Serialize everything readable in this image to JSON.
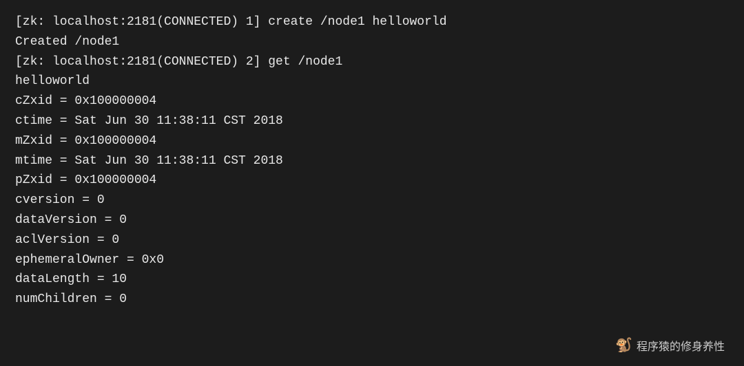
{
  "terminal": {
    "background": "#1c1c1c",
    "lines": [
      {
        "id": "line1",
        "text": "[zk: localhost:2181(CONNECTED) 1] create /node1 helloworld"
      },
      {
        "id": "line2",
        "text": "Created /node1"
      },
      {
        "id": "line3",
        "text": "[zk: localhost:2181(CONNECTED) 2] get /node1"
      },
      {
        "id": "line4",
        "text": "helloworld"
      },
      {
        "id": "line5",
        "text": "cZxid = 0x100000004"
      },
      {
        "id": "line6",
        "text": "ctime = Sat Jun 30 11:38:11 CST 2018"
      },
      {
        "id": "line7",
        "text": "mZxid = 0x100000004"
      },
      {
        "id": "line8",
        "text": "mtime = Sat Jun 30 11:38:11 CST 2018"
      },
      {
        "id": "line9",
        "text": "pZxid = 0x100000004"
      },
      {
        "id": "line10",
        "text": "cversion = 0"
      },
      {
        "id": "line11",
        "text": "dataVersion = 0"
      },
      {
        "id": "line12",
        "text": "aclVersion = 0"
      },
      {
        "id": "line13",
        "text": "ephemeralOwner = 0x0"
      },
      {
        "id": "line14",
        "text": "dataLength = 10"
      },
      {
        "id": "line15",
        "text": "numChildren = 0"
      }
    ]
  },
  "watermark": {
    "icon": "🐒",
    "text": "程序猿的修身养性"
  }
}
